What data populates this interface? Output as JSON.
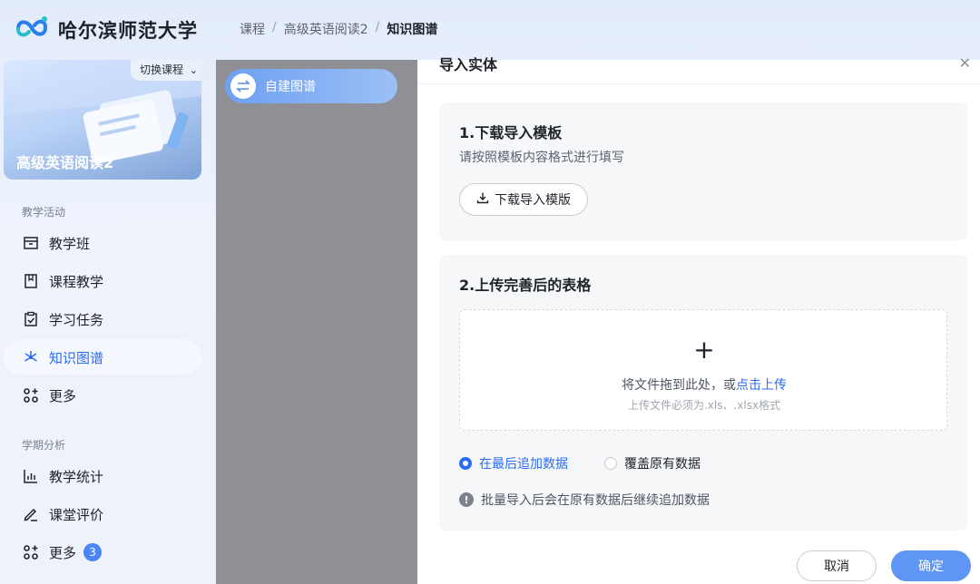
{
  "header": {
    "school_name": "哈尔滨师范大学",
    "breadcrumb": [
      "课程",
      "高级英语阅读2",
      "知识图谱"
    ]
  },
  "sidebar": {
    "switch_course": "切换课程",
    "course_name": "高级英语阅读2",
    "section_teaching": "教学活动",
    "section_analysis": "学期分析",
    "items": [
      {
        "label": "教学班",
        "icon": "class-icon"
      },
      {
        "label": "课程教学",
        "icon": "book-icon"
      },
      {
        "label": "学习任务",
        "icon": "task-icon"
      },
      {
        "label": "知识图谱",
        "icon": "graph-icon",
        "active": true
      },
      {
        "label": "更多",
        "icon": "grid-icon"
      },
      {
        "label": "教学统计",
        "icon": "chart-icon"
      },
      {
        "label": "课堂评价",
        "icon": "pen-icon"
      },
      {
        "label": "更多",
        "icon": "grid-icon",
        "badge": "3"
      }
    ]
  },
  "graph_tab": {
    "label": "自建图谱"
  },
  "modal": {
    "title": "导入实体",
    "step1_title": "1.下载导入模板",
    "step1_hint": "请按照模板内容格式进行填写",
    "download_label": "下载导入模版",
    "step2_title": "2.上传完善后的表格",
    "drop_text": "将文件拖到此处，或",
    "drop_link": "点击上传",
    "drop_sub": "上传文件必须为.xls、.xlsx格式",
    "option_append": "在最后追加数据",
    "option_overwrite": "覆盖原有数据",
    "selected_option": "在最后追加数据",
    "note": "批量导入后会在原有数据后继续追加数据",
    "cancel": "取消",
    "confirm": "确定"
  },
  "colors": {
    "accent": "#2c6cf5",
    "confirm_btn": "#5f96f5",
    "badge": "#4a86f7"
  }
}
